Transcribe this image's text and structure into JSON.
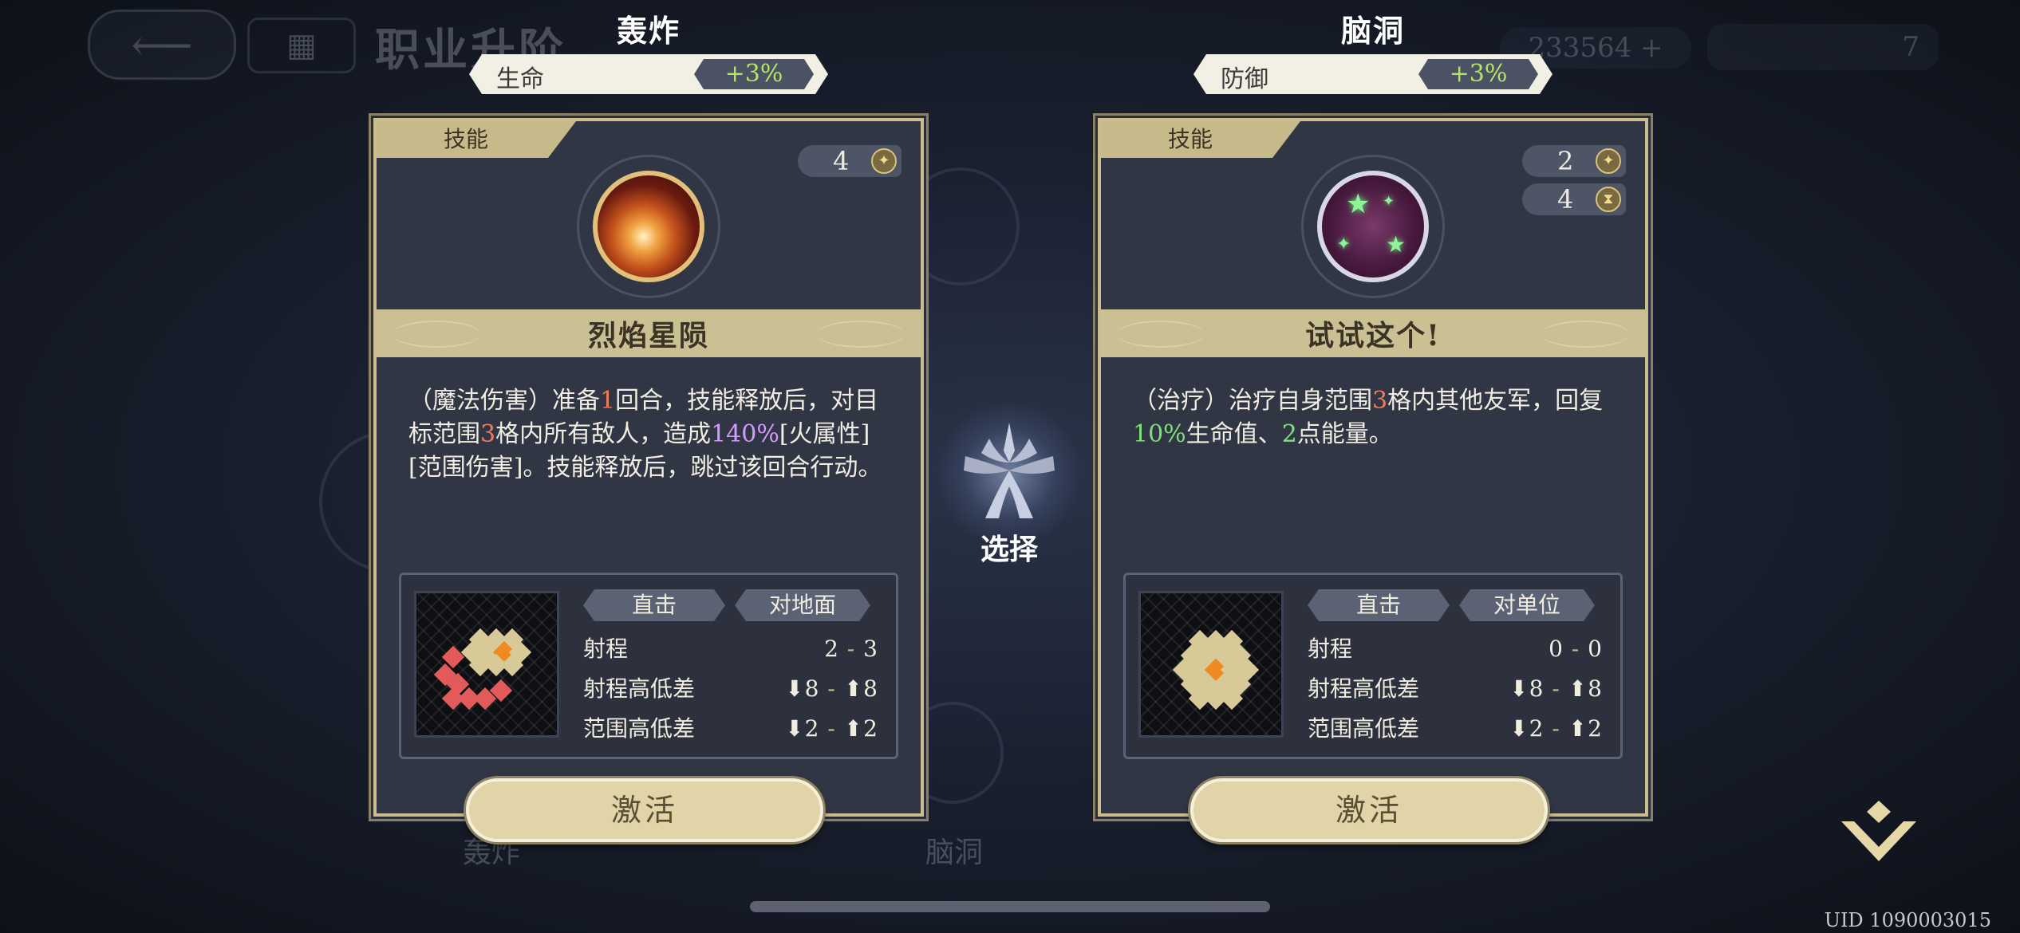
{
  "background": {
    "title": "职业升阶",
    "currency": "233564 +",
    "level": "7",
    "tabs": [
      "轰炸",
      "脑洞"
    ]
  },
  "center": {
    "select_label": "选择"
  },
  "options": [
    {
      "title": "轰炸",
      "stat": {
        "name": "生命",
        "value": "+3%"
      },
      "skill_tag": "技能",
      "costs": [
        "4"
      ],
      "skill_name": "烈焰星陨",
      "desc": {
        "p1": "（魔法伤害）准备",
        "n1": "1",
        "p2": "回合，技能释放后，对目标范围",
        "n2": "3",
        "p3": "格内所有敌人，造成",
        "n3": "140%",
        "p4": "[火属性][范围伤害]。技能释放后，跳过该回合行动。"
      },
      "pills": [
        "直击",
        "对地面"
      ],
      "rows": [
        {
          "label": "射程",
          "lo": "2",
          "hi": "3"
        },
        {
          "label": "射程高低差",
          "lo": "⬇8",
          "hi": "⬆8"
        },
        {
          "label": "范围高低差",
          "lo": "⬇2",
          "hi": "⬆2"
        }
      ],
      "activate_label": "激活"
    },
    {
      "title": "脑洞",
      "stat": {
        "name": "防御",
        "value": "+3%"
      },
      "skill_tag": "技能",
      "costs": [
        "2",
        "4"
      ],
      "skill_name": "试试这个!",
      "desc": {
        "p1": "（治疗）治疗自身范围",
        "n1": "3",
        "p2": "格内其他友军，回复",
        "n2": "10%",
        "p3": "生命值、",
        "n3": "2",
        "p4": "点能量。"
      },
      "pills": [
        "直击",
        "对单位"
      ],
      "rows": [
        {
          "label": "射程",
          "lo": "0",
          "hi": "0"
        },
        {
          "label": "射程高低差",
          "lo": "⬇8",
          "hi": "⬆8"
        },
        {
          "label": "范围高低差",
          "lo": "⬇2",
          "hi": "⬆2"
        }
      ],
      "activate_label": "激活"
    }
  ],
  "uid": "UID 1090003015",
  "icons": {
    "star_badge": "four-point-star-icon",
    "hourglass_badge": "hourglass-icon",
    "select_emblem": "tree-emblem-icon",
    "confirm": "chevron-confirm-icon"
  },
  "colors": {
    "accent_gold": "#cbbd8f",
    "bonus_green": "#b6e36a",
    "highlight_red": "#f07a5e",
    "highlight_purple": "#d49bff",
    "highlight_green": "#7ee07a"
  }
}
